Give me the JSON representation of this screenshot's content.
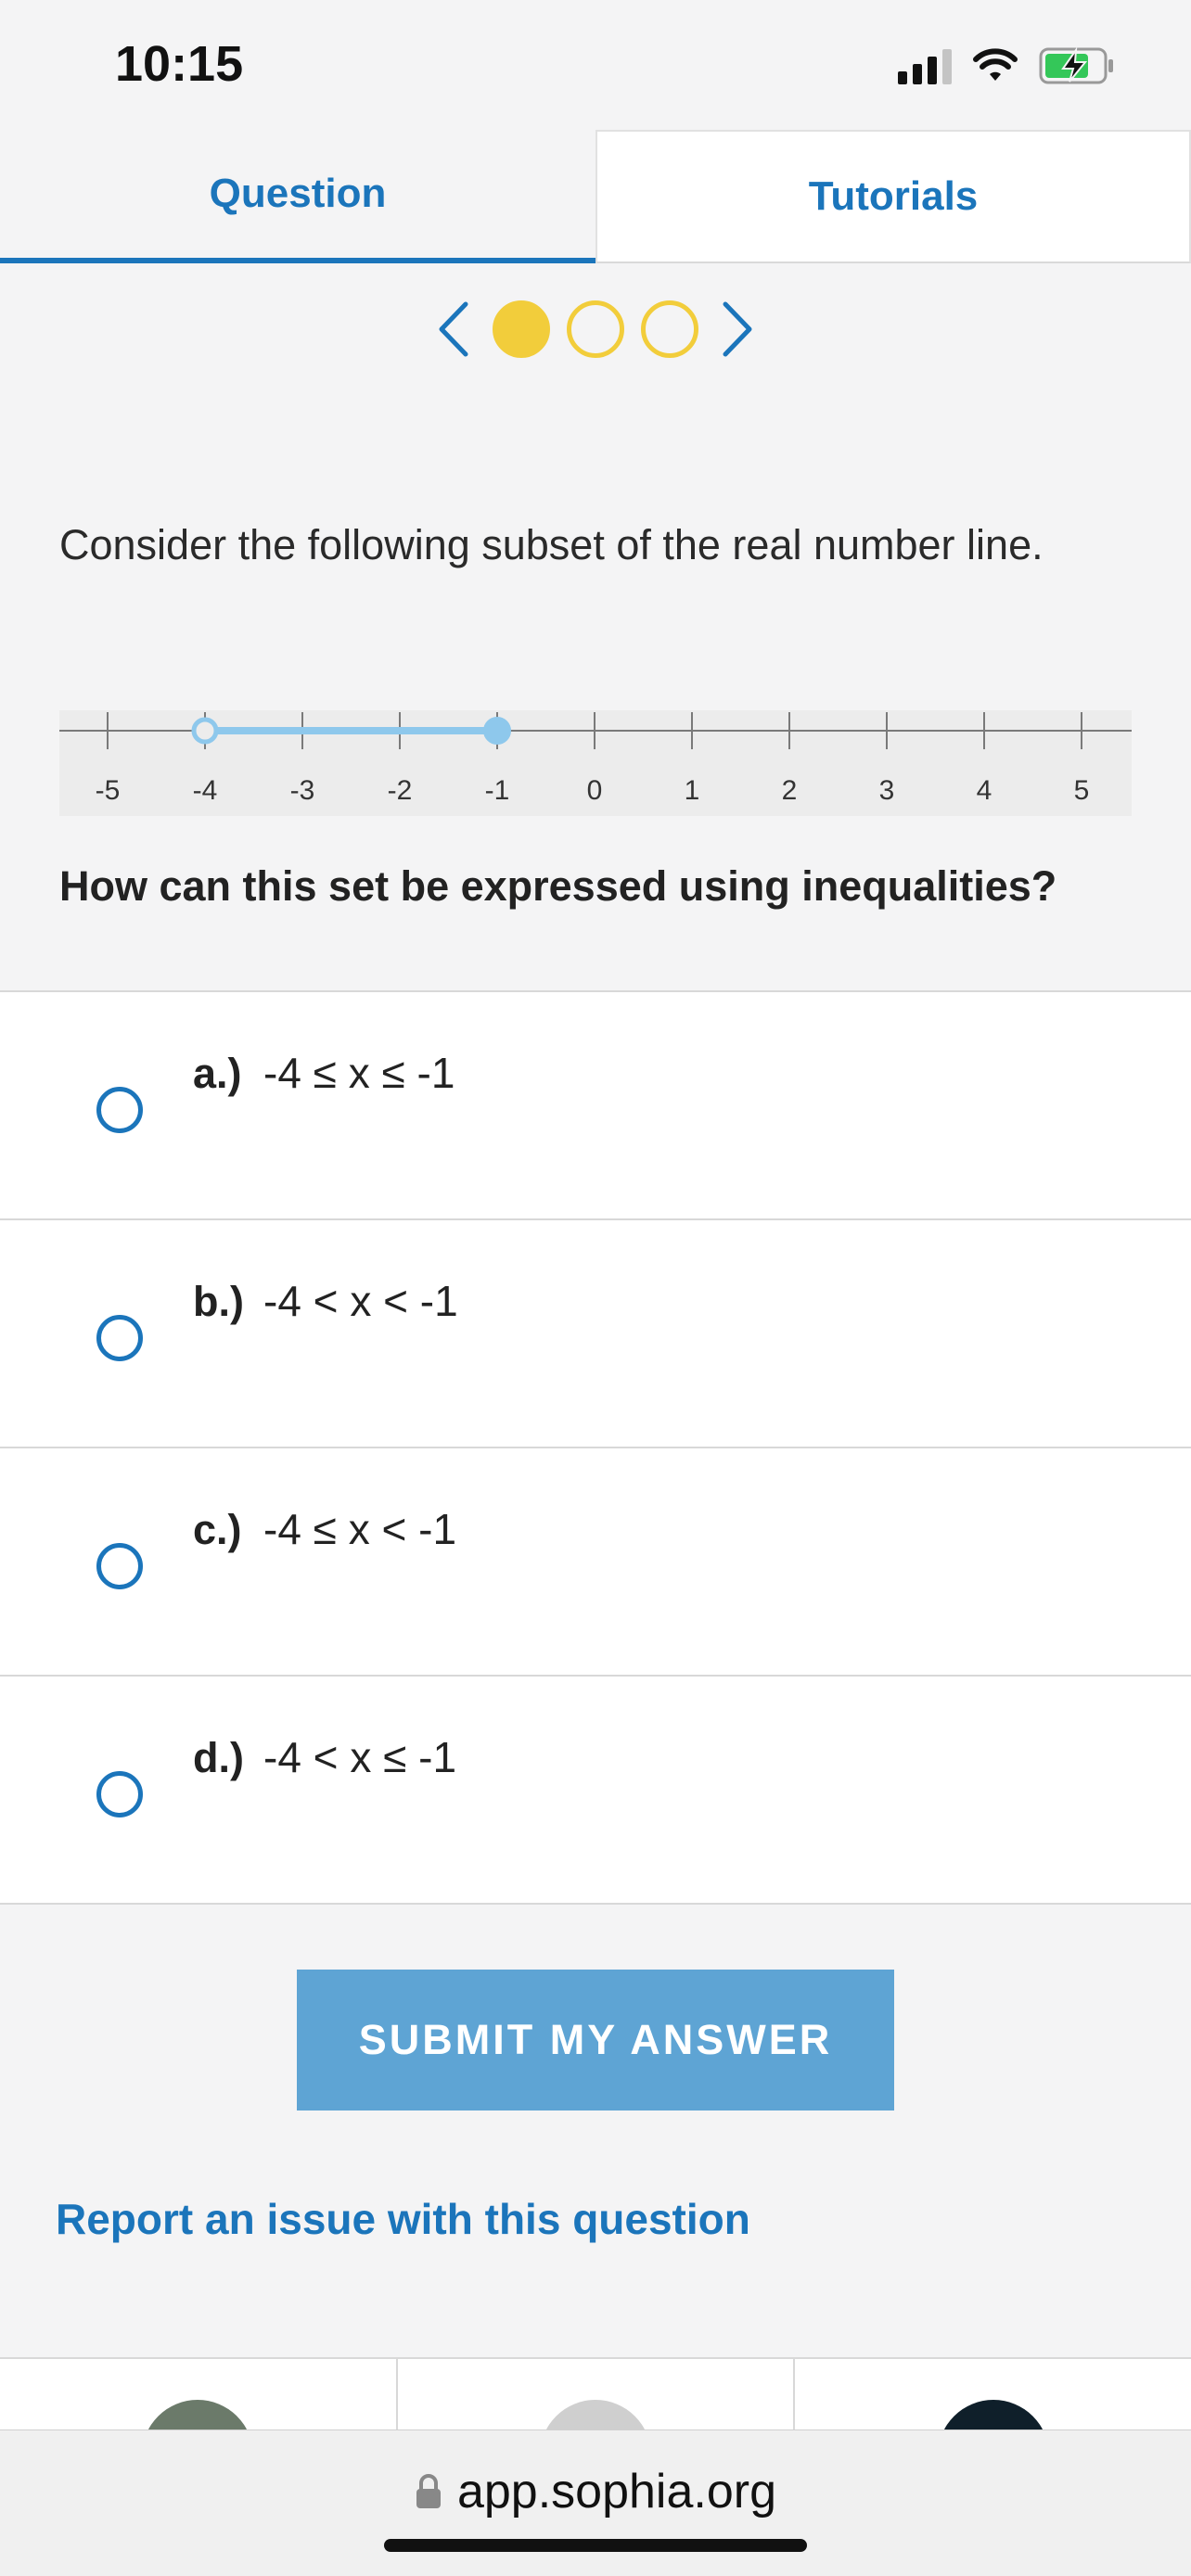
{
  "status_bar": {
    "time": "10:15"
  },
  "tabs": [
    {
      "label": "Question",
      "active": true
    },
    {
      "label": "Tutorials",
      "active": false
    }
  ],
  "pager": {
    "total": 3,
    "current": 1
  },
  "question": {
    "prompt": "Consider the following subset of the real number line.",
    "ask": "How can this set be expressed using inequalities?"
  },
  "number_line": {
    "ticks": [
      "-5",
      "-4",
      "-3",
      "-2",
      "-1",
      "0",
      "1",
      "2",
      "3",
      "4",
      "5"
    ],
    "interval": {
      "start": -4,
      "end": -1,
      "start_closed": false,
      "end_closed": true
    },
    "color": "#8ec8ec"
  },
  "choices": [
    {
      "letter": "a.)",
      "text": "-4 ≤ x ≤ -1"
    },
    {
      "letter": "b.)",
      "text": "-4 < x < -1"
    },
    {
      "letter": "c.)",
      "text": "-4 ≤ x < -1"
    },
    {
      "letter": "d.)",
      "text": "-4 < x ≤ -1"
    }
  ],
  "submit_label": "SUBMIT MY ANSWER",
  "report_label": "Report an issue with this question",
  "browser": {
    "url": "app.sophia.org"
  },
  "colors": {
    "accent": "#1b75bb",
    "pager_dot": "#f2cd3b",
    "submit_bg": "#5ea4d4"
  }
}
